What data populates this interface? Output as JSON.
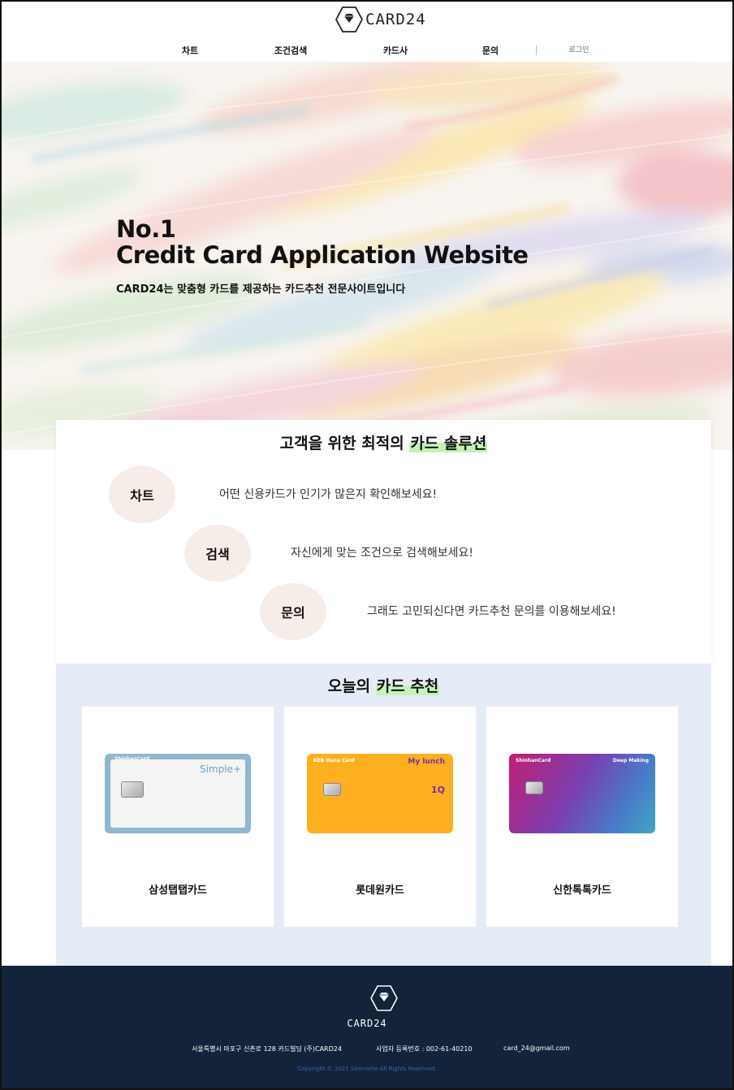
{
  "header": {
    "brand": "CARD24",
    "nav": [
      {
        "label": "차트"
      },
      {
        "label": "조건검색"
      },
      {
        "label": "카드사"
      },
      {
        "label": "문의"
      }
    ],
    "login_label": "로그인"
  },
  "hero": {
    "title_line1": "No.1",
    "title_line2": "Credit Card Application Website",
    "subtitle": "CARD24는 맞춤형 카드를 제공하는 카드추천 전문사이트입니다"
  },
  "solutions": {
    "title_prefix": "고객을 위한 최적의 ",
    "title_highlight": "카드 솔루션",
    "features": [
      {
        "label": "차트",
        "description": "어떤 신용카드가 인기가 많은지 확인해보세요!"
      },
      {
        "label": "검색",
        "description": "자신에게 맞는 조건으로 검색해보세요!"
      },
      {
        "label": "문의",
        "description": "그래도 고민되신다면 카드추천 문의를 이용해보세요!"
      }
    ]
  },
  "recommend": {
    "title_prefix": "오늘의 ",
    "title_highlight": "카드 추천",
    "cards": [
      {
        "name": "삼성탭탭카드",
        "issuer_text": "ShinhanCard",
        "product_text": "Simple+",
        "brand_color": "#8fb7cf"
      },
      {
        "name": "롯데원카드",
        "issuer_text": "KEB Hana Card",
        "product_text": "My lunch",
        "brand_color": "#ffb020"
      },
      {
        "name": "신한톡톡카드",
        "issuer_text": "ShinhanCard",
        "product_text": "Deep Making",
        "brand_color": "#7a3fb0"
      }
    ]
  },
  "footer": {
    "brand": "CARD24",
    "address": "서울특별시 마포구 신촌로 128 카드빌딩 (주)CARD24",
    "business_no": "사업자 등록번호 : 002-61-40210",
    "email": "card_24@gmail.com",
    "copyright": "Copyright © 2021 Sitename All Rights Reserved."
  },
  "colors": {
    "highlight": "#c6f2b6",
    "bubble": "#f6ece8",
    "recommend_bg": "#e6ecf7",
    "footer_bg": "#13233a"
  },
  "icons": [
    "diamond-logo-icon"
  ]
}
